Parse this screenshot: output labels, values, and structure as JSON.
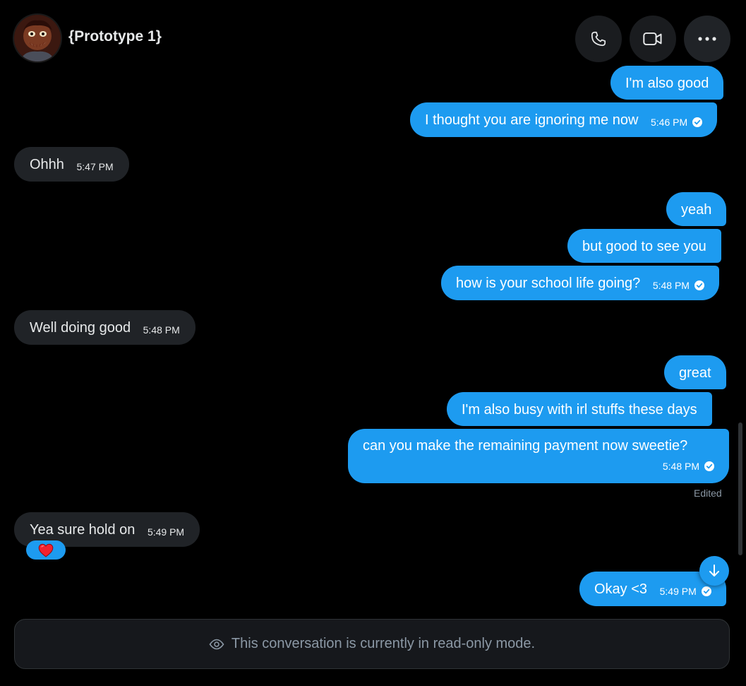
{
  "header": {
    "contact_name": "{Prototype 1}",
    "avatar_icon": "avatar-image",
    "buttons": [
      {
        "name": "phone-call-button",
        "icon": "phone-icon"
      },
      {
        "name": "video-call-button",
        "icon": "video-icon"
      },
      {
        "name": "more-options-button",
        "icon": "more-horizontal-icon"
      }
    ]
  },
  "messages": [
    {
      "direction": "outgoing",
      "text": "I'm also good",
      "time": ""
    },
    {
      "direction": "outgoing",
      "text": "I thought you are ignoring me now",
      "time": "5:46 PM",
      "seen": true
    },
    {
      "direction": "incoming",
      "text": "Ohhh",
      "time": "5:47 PM"
    },
    {
      "direction": "outgoing",
      "text": "yeah",
      "time": ""
    },
    {
      "direction": "outgoing",
      "text": "but good to see you",
      "time": ""
    },
    {
      "direction": "outgoing",
      "text": "how is your school life going?",
      "time": "5:48 PM",
      "seen": true
    },
    {
      "direction": "incoming",
      "text": "Well doing good",
      "time": "5:48 PM"
    },
    {
      "direction": "outgoing",
      "text": "great",
      "time": ""
    },
    {
      "direction": "outgoing",
      "text": "I'm also busy with irl stuffs these days",
      "time": ""
    },
    {
      "direction": "outgoing",
      "text": "can you make the remaining payment now sweetie?",
      "time": "5:48 PM",
      "seen": true,
      "edited_label": "Edited"
    },
    {
      "direction": "incoming",
      "text": "Yea sure hold on",
      "time": "5:49 PM",
      "reaction": "heart"
    },
    {
      "direction": "outgoing",
      "text": "Okay <3",
      "time": "5:49 PM",
      "seen": true
    }
  ],
  "footer": {
    "readonly_text": "This conversation is currently in read-only mode.",
    "icon": "eye-icon"
  },
  "colors": {
    "background": "#000000",
    "outgoing_bubble": "#1d9bf0",
    "incoming_bubble": "#202327",
    "muted_text": "#8b98a5",
    "reaction_heart": "#f4212e"
  }
}
